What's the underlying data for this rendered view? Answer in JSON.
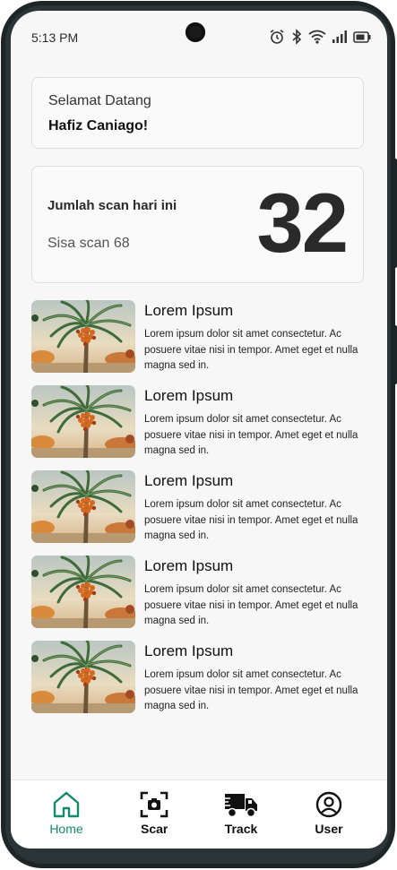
{
  "status_bar": {
    "time": "5:13 PM",
    "icons": [
      "alarm-icon",
      "bluetooth-icon",
      "wifi-icon",
      "signal-icon",
      "battery-icon"
    ]
  },
  "welcome": {
    "greeting": "Selamat Datang",
    "name": "Hafiz Caniago!"
  },
  "scan_stats": {
    "title": "Jumlah scan hari ini",
    "remaining_text": "Sisa scan 68",
    "count": "32"
  },
  "articles": [
    {
      "title": "Lorem Ipsum",
      "description": "Lorem ipsum dolor sit amet consectetur. Ac posuere vitae nisi in tempor. Amet eget et nulla magna sed in.",
      "image": "date-palm-image"
    },
    {
      "title": "Lorem Ipsum",
      "description": "Lorem ipsum dolor sit amet consectetur. Ac posuere vitae nisi in tempor. Amet eget et nulla magna sed in.",
      "image": "date-palm-image"
    },
    {
      "title": "Lorem Ipsum",
      "description": "Lorem ipsum dolor sit amet consectetur. Ac posuere vitae nisi in tempor. Amet eget et nulla magna sed in.",
      "image": "date-palm-image"
    },
    {
      "title": "Lorem Ipsum",
      "description": "Lorem ipsum dolor sit amet consectetur. Ac posuere vitae nisi in tempor. Amet eget et nulla magna sed in.",
      "image": "date-palm-image"
    },
    {
      "title": "Lorem Ipsum",
      "description": "Lorem ipsum dolor sit amet consectetur. Ac posuere vitae nisi in tempor. Amet eget et nulla magna sed in.",
      "image": "date-palm-image"
    }
  ],
  "bottom_nav": {
    "items": [
      {
        "label": "Home",
        "icon": "home-icon",
        "active": true
      },
      {
        "label": "Scan",
        "icon": "camera-scan-icon",
        "active": false
      },
      {
        "label": "Track",
        "icon": "truck-icon",
        "active": false
      },
      {
        "label": "User",
        "icon": "user-icon",
        "active": false
      }
    ]
  },
  "colors": {
    "accent": "#138a6d",
    "text": "#111111",
    "card_border": "#dedede",
    "background": "#f7f7f7"
  }
}
